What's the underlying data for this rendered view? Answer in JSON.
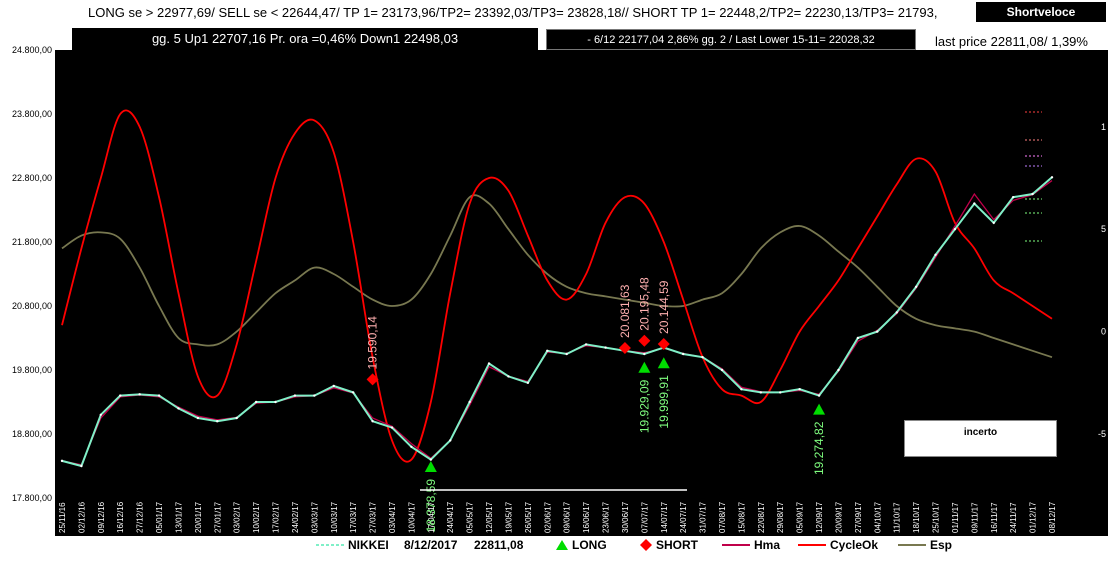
{
  "header": {
    "line1": "LONG se > 22977,69/   SELL se < 22644,47/  TP 1= 23173,96/TP2=  23392,03/TP3=  23828,18//    SHORT  TP 1= 22448,2/TP2=  22230,13/TP3=  21793,",
    "shortveloce": "Shortveloce",
    "box1": "gg. 5 Up1  22707,16   Pr. ora =0,46%   Down1  22498,03",
    "box2": "-  6/12   22177,04  2,86%  gg. 2 / Last Lower 15-11= 22028,32",
    "last_price": "last price 22811,08/  1,39%"
  },
  "incerto_label": "incerto",
  "legend": {
    "nikkei": "NIKKEI",
    "date": "8/12/2017",
    "price": "22811,08",
    "long": "LONG",
    "short": "SHORT",
    "hma": "Hma",
    "cycleok": "CycleOk",
    "esp": "Esp"
  },
  "colors": {
    "nikkei": "#80f0c8",
    "long": "#00dd00",
    "short": "#ff0000",
    "hma": "#c0004a",
    "cycleok": "#ff0000",
    "esp": "#787850",
    "background": "#000000"
  },
  "chart_data": {
    "type": "line",
    "ylim": [
      17800,
      24800
    ],
    "yticks": [
      "24.800,00",
      "23.800,00",
      "22.800,00",
      "21.800,00",
      "20.800,00",
      "19.800,00",
      "18.800,00",
      "17.800,00"
    ],
    "ytick_values": [
      24800,
      23800,
      22800,
      21800,
      20800,
      19800,
      18800,
      17800
    ],
    "right_ticks": [
      "1",
      "5",
      "0",
      "-5"
    ],
    "right_tick_values": [
      23600,
      22000,
      20400,
      18800
    ],
    "x": [
      "25/11/16",
      "02/12/16",
      "09/12/16",
      "16/12/16",
      "27/12/16",
      "05/01/17",
      "13/01/17",
      "20/01/17",
      "27/01/17",
      "03/02/17",
      "10/02/17",
      "17/02/17",
      "24/02/17",
      "03/03/17",
      "10/03/17",
      "17/03/17",
      "27/03/17",
      "03/04/17",
      "10/04/17",
      "17/04/17",
      "24/04/17",
      "05/05/17",
      "12/05/17",
      "19/05/17",
      "26/05/17",
      "02/06/17",
      "09/06/17",
      "16/06/17",
      "23/06/17",
      "30/06/17",
      "07/07/17",
      "14/07/17",
      "24/07/17",
      "31/07/17",
      "07/08/17",
      "15/08/17",
      "22/08/17",
      "29/08/17",
      "05/09/17",
      "12/09/17",
      "20/09/17",
      "27/09/17",
      "04/10/17",
      "11/10/17",
      "18/10/17",
      "25/10/17",
      "01/11/17",
      "09/11/17",
      "16/11/17",
      "24/11/17",
      "01/12/17",
      "08/12/17"
    ],
    "series": [
      {
        "name": "NIKKEI",
        "values": [
          18380,
          18300,
          19100,
          19400,
          19420,
          19400,
          19200,
          19050,
          19000,
          19050,
          19300,
          19300,
          19400,
          19400,
          19550,
          19450,
          19000,
          18900,
          18600,
          18400,
          18700,
          19300,
          19900,
          19700,
          19600,
          20100,
          20050,
          20200,
          20150,
          20100,
          20050,
          20150,
          20050,
          20000,
          19800,
          19500,
          19450,
          19450,
          19500,
          19400,
          19800,
          20300,
          20400,
          20700,
          21100,
          21600,
          22000,
          22400,
          22100,
          22500,
          22550,
          22811
        ]
      },
      {
        "name": "Hma",
        "values": [
          18380,
          18320,
          19050,
          19380,
          19410,
          19380,
          19220,
          19080,
          19020,
          19060,
          19280,
          19300,
          19380,
          19400,
          19520,
          19440,
          19050,
          18920,
          18650,
          18420,
          18700,
          19250,
          19850,
          19700,
          19620,
          20080,
          20060,
          20180,
          20150,
          20100,
          20070,
          20140,
          20060,
          20000,
          19820,
          19530,
          19460,
          19450,
          19480,
          19420,
          19780,
          20250,
          20420,
          20680,
          21080,
          21560,
          22050,
          22550,
          22150,
          22450,
          22540,
          22760
        ]
      },
      {
        "name": "CycleOk",
        "values": [
          20500,
          21700,
          22800,
          23800,
          23600,
          22500,
          21000,
          19700,
          19400,
          20200,
          21500,
          22800,
          23500,
          23700,
          23200,
          21800,
          20000,
          18700,
          18400,
          19300,
          21000,
          22400,
          22800,
          22600,
          21900,
          21200,
          20900,
          21300,
          22100,
          22500,
          22400,
          21800,
          20900,
          20000,
          19500,
          19400,
          19300,
          19800,
          20400,
          20800,
          21200,
          21700,
          22200,
          22700,
          23100,
          22900,
          22100,
          21700,
          21200,
          21000,
          20800,
          20600
        ]
      },
      {
        "name": "Esp",
        "values": [
          21700,
          21900,
          21950,
          21850,
          21400,
          20800,
          20300,
          20200,
          20200,
          20400,
          20700,
          21000,
          21200,
          21400,
          21300,
          21100,
          20900,
          20800,
          20900,
          21300,
          21900,
          22500,
          22400,
          22000,
          21600,
          21300,
          21100,
          21000,
          20950,
          20900,
          20850,
          20800,
          20800,
          20900,
          21000,
          21300,
          21700,
          21950,
          22050,
          21900,
          21650,
          21400,
          21100,
          20800,
          20600,
          20500,
          20450,
          20400,
          20300,
          20200,
          20100,
          20000
        ]
      }
    ],
    "long_signals": [
      {
        "x": "17/04/17",
        "value": 18378.59,
        "label": "18.378,59"
      },
      {
        "x": "07/07/17",
        "value": 19929.09,
        "label": "19.929,09"
      },
      {
        "x": "14/07/17",
        "value": 19999.91,
        "label": "19.999,91"
      },
      {
        "x": "12/09/17",
        "value": 19274.82,
        "label": "19.274,82"
      }
    ],
    "short_signals": [
      {
        "x": "27/03/17",
        "value": 19590.14,
        "label": "19.590,14"
      },
      {
        "x": "30/06/17",
        "value": 20081.63,
        "label": "20.081,63"
      },
      {
        "x": "07/07/17",
        "value": 20195.48,
        "label": "20.195,48"
      },
      {
        "x": "14/07/17",
        "value": 20144.59,
        "label": "20.144,59"
      }
    ]
  }
}
